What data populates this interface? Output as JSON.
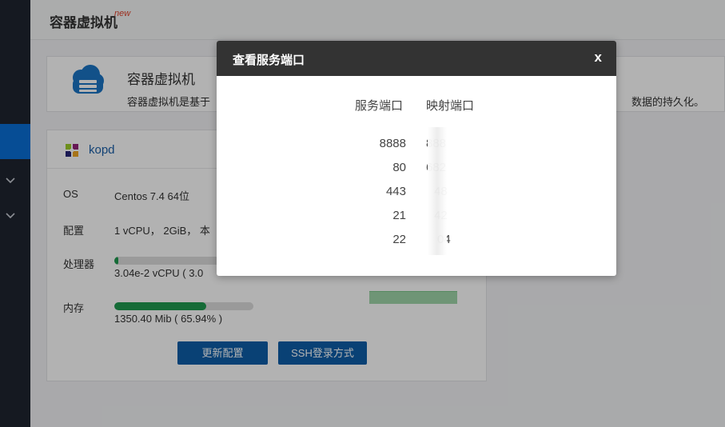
{
  "topbar": {
    "title": "容器虚拟机",
    "new_tag": "new"
  },
  "intro": {
    "heading": "容器虚拟机",
    "description": "容器虚拟机是基于",
    "description_tail": "数据的持久化。"
  },
  "vm": {
    "name": "kopd",
    "rows": [
      {
        "label": "OS",
        "value": "Centos 7.4 64位"
      },
      {
        "label": "配置",
        "value": "1 vCPU， 2GiB， 本"
      },
      {
        "label": "处理器",
        "value": "3.04e-2 vCPU ( 3.0"
      },
      {
        "label": "内存",
        "value": "1350.40 Mib ( 65.94% )"
      }
    ],
    "cpu_usage_fraction": 0.03,
    "mem_usage_fraction": 0.6594,
    "buttons": {
      "update": "更新配置",
      "ssh": "SSH登录方式"
    }
  },
  "modal": {
    "title": "查看服务端口",
    "close": "x",
    "col_service": "服务端口",
    "col_mapped": "映射端口",
    "rows": [
      {
        "service": "8888",
        "mapped": "888"
      },
      {
        "service": "80",
        "mapped": "682"
      },
      {
        "service": "443",
        "mapped": "48"
      },
      {
        "service": "21",
        "mapped": "42"
      },
      {
        "service": "22",
        "mapped": "04"
      }
    ]
  },
  "colors": {
    "accent": "#0d5ea8",
    "progress": "#1f9a4f",
    "sidebar": "#1f2530",
    "modal_header": "#333333"
  }
}
